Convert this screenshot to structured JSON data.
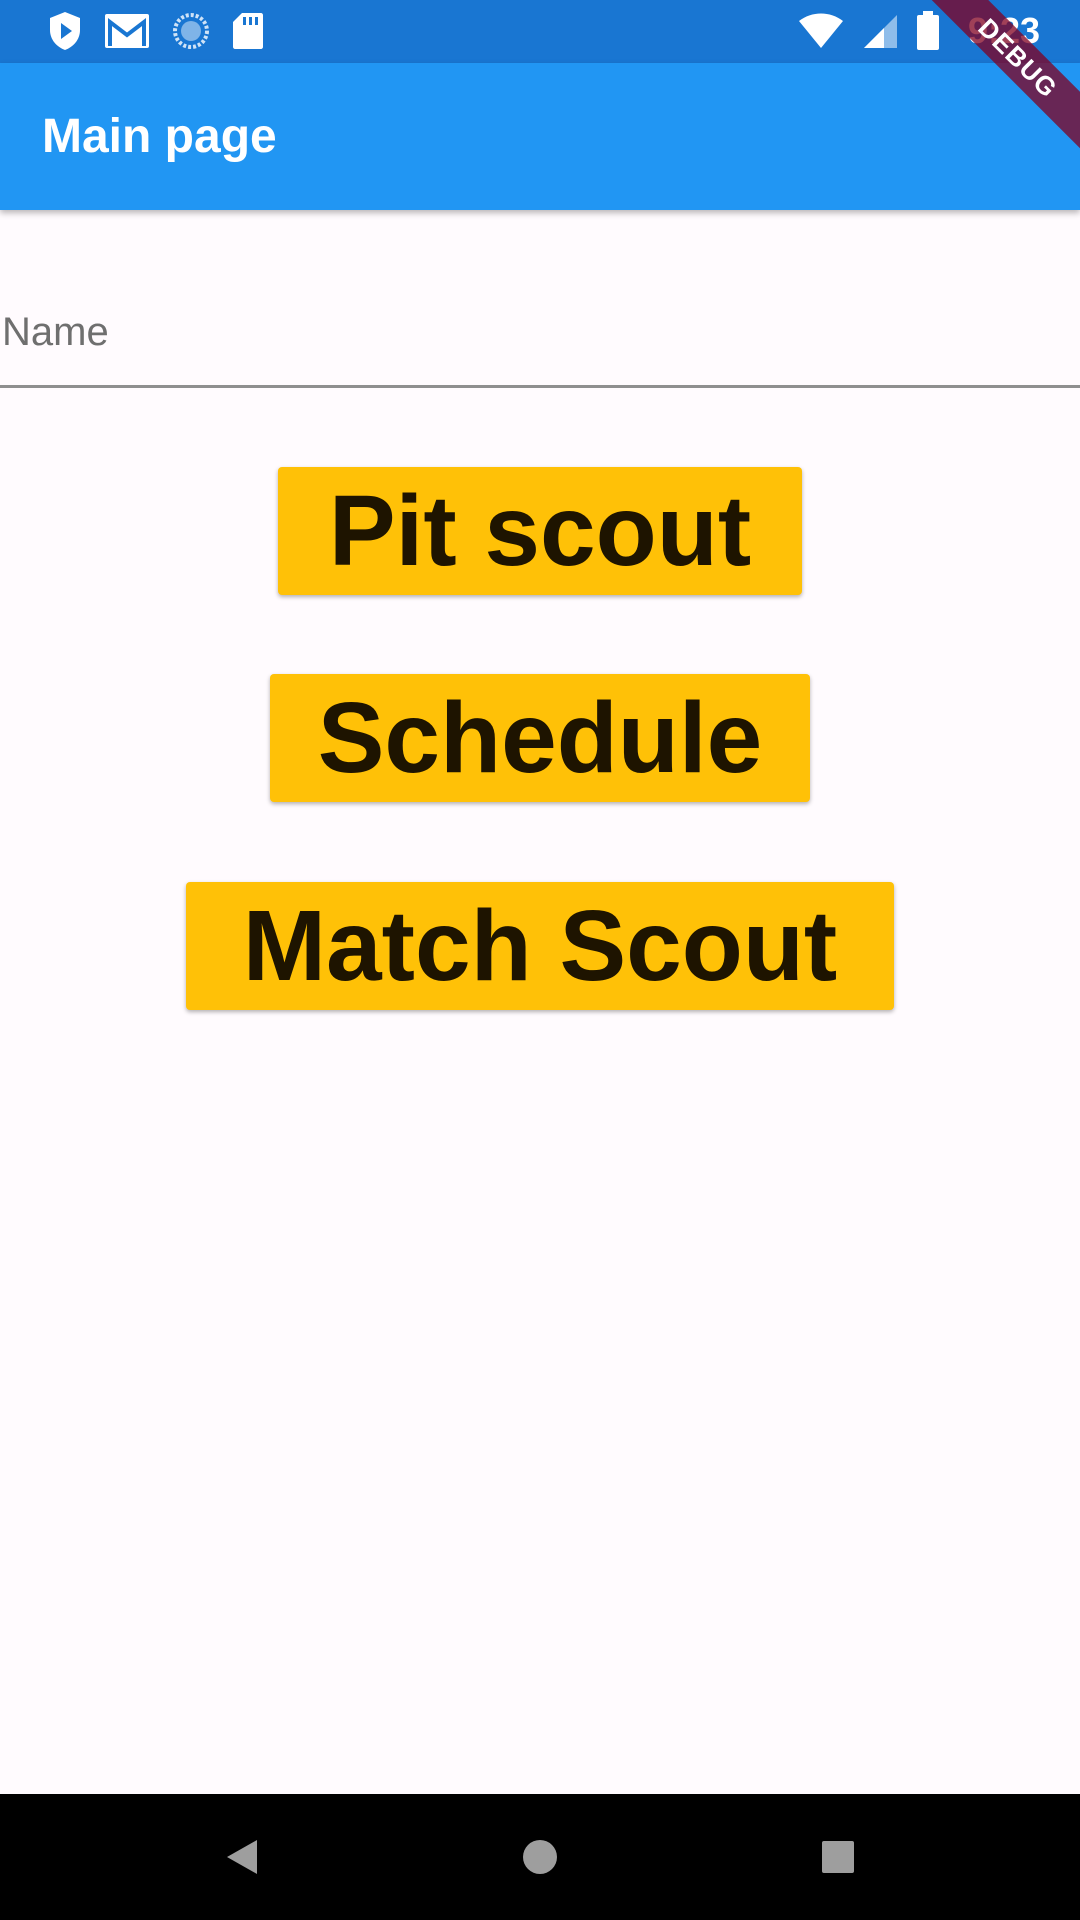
{
  "status_bar": {
    "time": "9:23",
    "left_icons": [
      "play-protect-icon",
      "gmail-icon",
      "sync-icon",
      "sd-card-icon"
    ],
    "right_icons": [
      "wifi-icon",
      "signal-icon",
      "battery-icon"
    ],
    "background_color": "#1976d2"
  },
  "app_bar": {
    "title": "Main page",
    "background_color": "#2196f3"
  },
  "debug_banner": {
    "label": "DEBUG"
  },
  "form": {
    "name_placeholder": "Name",
    "name_value": ""
  },
  "buttons": {
    "pit_scout": "Pit scout",
    "schedule": "Schedule",
    "match_scout": "Match Scout",
    "background_color": "#ffc107"
  },
  "nav_bar": {
    "icons": [
      "back-icon",
      "home-icon",
      "recents-icon"
    ]
  }
}
